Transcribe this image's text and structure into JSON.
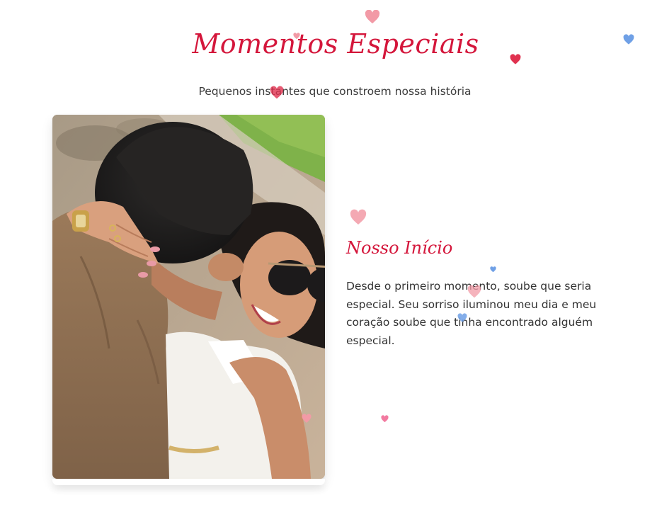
{
  "section": {
    "title": "Momentos Especiais",
    "subtitle": "Pequenos instantes que constroem nossa história"
  },
  "moment": {
    "title": "Nosso Início",
    "text": "Desde o primeiro momento, soube que seria especial. Seu sorriso iluminou meu dia e meu coração soube que tinha encontrado alguém especial."
  },
  "colors": {
    "accent": "#d4163b",
    "text": "#333333",
    "heart_pink": "#f29aa6",
    "heart_red": "#e0314f",
    "heart_blue": "#6fa0e6"
  },
  "decorations": {
    "heart_icon": "floating-heart-icon"
  }
}
